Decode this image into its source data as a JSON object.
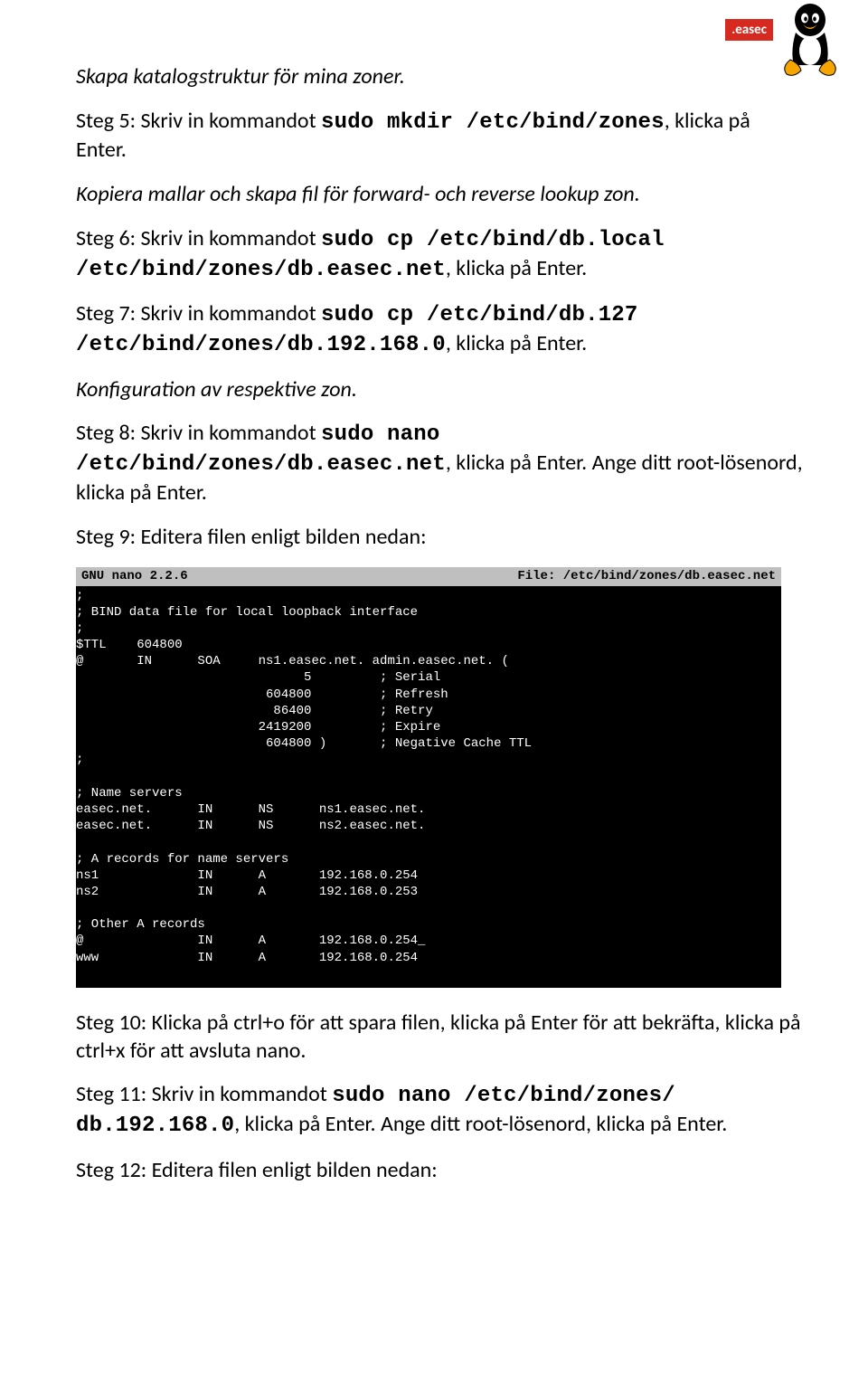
{
  "logo": {
    "label": ".easec"
  },
  "p1": "Skapa katalogstruktur för mina zoner.",
  "p2a": "Steg 5: Skriv in kommandot ",
  "p2b": "sudo mkdir /etc/bind/zones",
  "p2c": ", klicka på Enter.",
  "p3": "Kopiera mallar och skapa fil för forward- och reverse lookup zon.",
  "p4a": "Steg 6: Skriv in kommandot ",
  "p4b": "sudo cp /etc/bind/db.local /etc/bind/zones/db.easec.net",
  "p4c": ", klicka på Enter.",
  "p5a": "Steg 7: Skriv in kommandot ",
  "p5b": "sudo cp /etc/bind/db.127 /etc/bind/zones/db.192.168.0",
  "p5c": ", klicka på Enter.",
  "p6": "Konfiguration av respektive zon.",
  "p7a": "Steg 8: Skriv in kommandot ",
  "p7b": "sudo nano /etc/bind/zones/db.easec.net",
  "p7c": ", klicka på Enter. Ange ditt root-lösenord, klicka på Enter.",
  "p8": "Steg 9: Editera filen enligt bilden nedan:",
  "terminal": {
    "headerLeft": "  GNU nano 2.2.6",
    "headerRight": "File: /etc/bind/zones/db.easec.net          ",
    "body": ";\n; BIND data file for local loopback interface\n;\n$TTL    604800\n@       IN      SOA     ns1.easec.net. admin.easec.net. (\n                              5         ; Serial\n                         604800         ; Refresh\n                          86400         ; Retry\n                        2419200         ; Expire\n                         604800 )       ; Negative Cache TTL\n;\n\n; Name servers\neasec.net.      IN      NS      ns1.easec.net.\neasec.net.      IN      NS      ns2.easec.net.\n\n; A records for name servers\nns1             IN      A       192.168.0.254\nns2             IN      A       192.168.0.253\n\n; Other A records\n@               IN      A       192.168.0.254_\nwww             IN      A       192.168.0.254"
  },
  "p9": "Steg 10: Klicka på ctrl+o för att spara filen, klicka på Enter för att bekräfta, klicka på ctrl+x för att avsluta nano.",
  "p10a": "Steg 11: Skriv in kommandot ",
  "p10b": "sudo nano /etc/bind/zones/ db.192.168.0",
  "p10c": ", klicka på Enter. Ange ditt root-lösenord, klicka på Enter.",
  "p11": "Steg 12: Editera filen enligt bilden nedan:"
}
